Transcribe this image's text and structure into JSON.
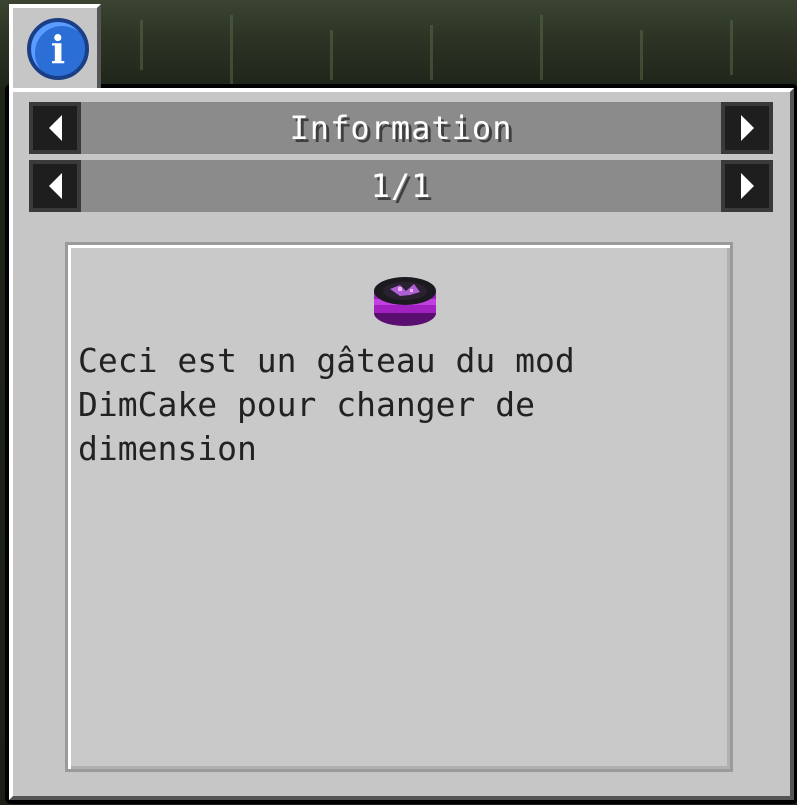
{
  "tab": {
    "icon": "info-icon",
    "icon_glyph": "i",
    "color": "#2b6fd6"
  },
  "header": {
    "title": "Information"
  },
  "pager": {
    "page": "1/1"
  },
  "entry": {
    "item_icon": "dimcake-icon",
    "text": "Ceci est un gâteau du mod\nDimCake pour changer de\ndimension"
  },
  "colors": {
    "panel": "#c6c6c6",
    "row": "#8b8b8b",
    "accent_cake": "#a020c0"
  }
}
